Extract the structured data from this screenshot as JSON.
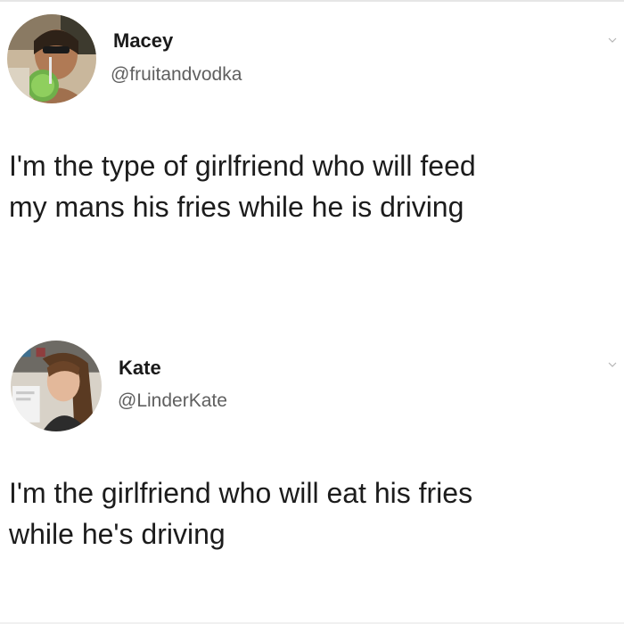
{
  "tweets": [
    {
      "display_name": "Macey",
      "handle": "@fruitandvodka",
      "text_lines": [
        "I'm the type of girlfriend who will feed",
        "my mans his fries while he is driving"
      ],
      "avatar_icon": "profile-photo-avatar",
      "menu_icon": "chevron-down-icon"
    },
    {
      "display_name": "Kate",
      "handle": "@LinderKate",
      "text_lines": [
        "I'm the girlfriend who will eat his fries",
        "while he's driving"
      ],
      "avatar_icon": "profile-photo-avatar",
      "menu_icon": "chevron-down-icon"
    }
  ]
}
